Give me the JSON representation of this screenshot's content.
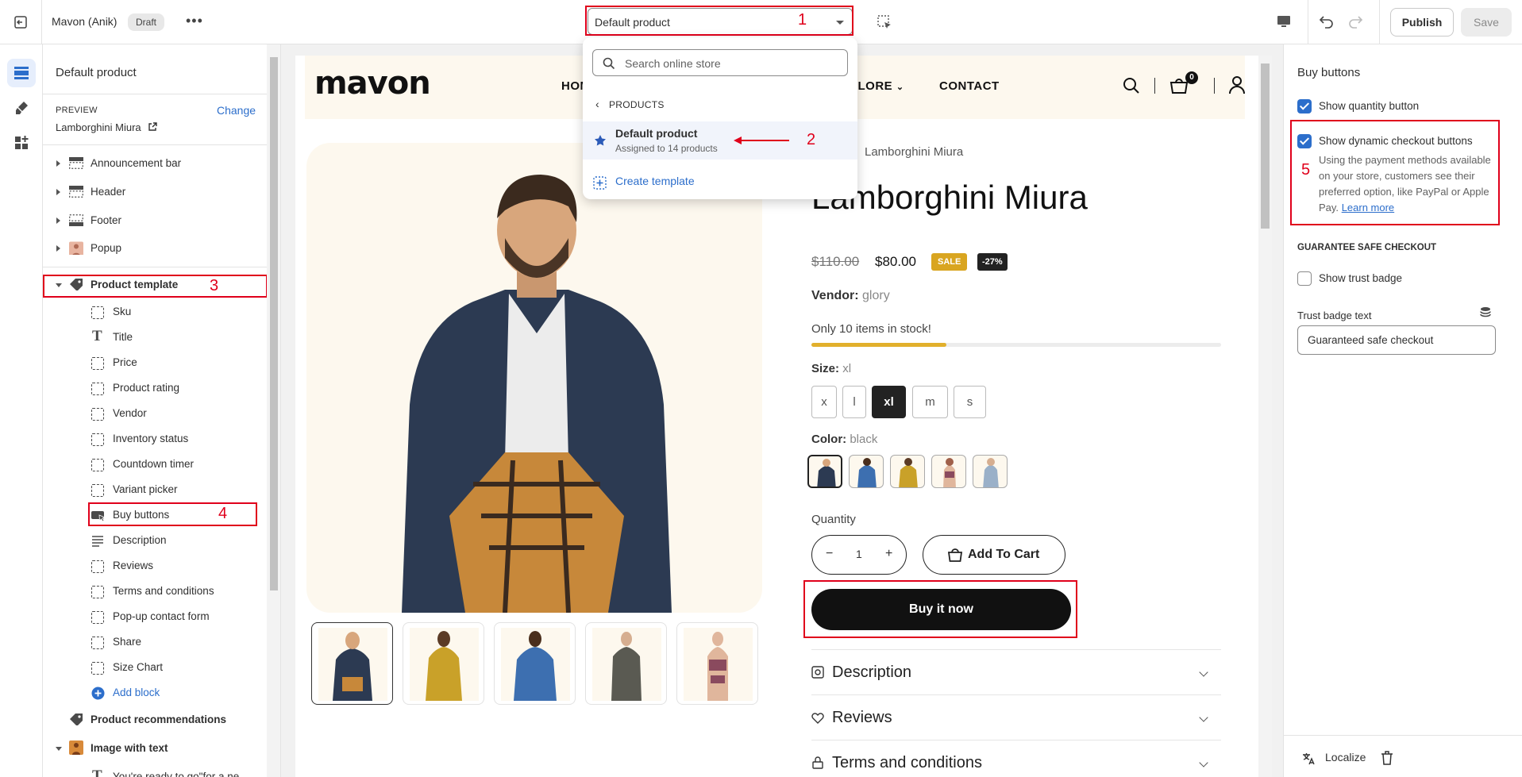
{
  "topbar": {
    "store_name": "Mavon (Anik)",
    "status_badge": "Draft",
    "template_select": "Default product",
    "publish_label": "Publish",
    "save_label": "Save"
  },
  "annotations": [
    "1",
    "2",
    "3",
    "4",
    "5"
  ],
  "template_dropdown": {
    "search_placeholder": "Search online store",
    "back_label": "PRODUCTS",
    "item_name": "Default product",
    "item_sub": "Assigned to 14 products",
    "create_label": "Create template"
  },
  "left_panel": {
    "title": "Default product",
    "preview_label": "PREVIEW",
    "change_label": "Change",
    "preview_product": "Lamborghini Miura",
    "sections": [
      {
        "label": "Announcement bar",
        "icon": "section-icon"
      },
      {
        "label": "Header",
        "icon": "section-icon"
      },
      {
        "label": "Footer",
        "icon": "section-icon"
      },
      {
        "label": "Popup",
        "icon": "image-icon"
      }
    ],
    "product_template": "Product template",
    "blocks": [
      "Sku",
      "Title",
      "Price",
      "Product rating",
      "Vendor",
      "Inventory status",
      "Countdown timer",
      "Variant picker",
      "Buy buttons",
      "Description",
      "Reviews",
      "Terms and conditions",
      "Pop-up contact form",
      "Share",
      "Size Chart"
    ],
    "add_block": "Add block",
    "product_recommendations": "Product recommendations",
    "image_with_text": "Image with text",
    "cut_text": "You're ready to go\"for a ne"
  },
  "store": {
    "logo": "mavon",
    "nav": [
      "HOME",
      "EXPLORE",
      "CONTACT"
    ],
    "cart_count": "0",
    "breadcrumb": "Lamborghini Miura",
    "product_title": "Lamborghini Miura",
    "price_old": "$110.00",
    "price_new": "$80.00",
    "badge_sale": "SALE",
    "badge_off": "-27%",
    "vendor_label": "Vendor:",
    "vendor_value": "glory",
    "stock_text": "Only 10 items in stock!",
    "stock_fraction": 0.33,
    "size_label": "Size:",
    "size_value": "xl",
    "sizes": [
      "x",
      "l",
      "xl",
      "m",
      "s"
    ],
    "color_label": "Color:",
    "color_value": "black",
    "quantity_label": "Quantity",
    "quantity_value": "1",
    "add_to_cart": "Add To Cart",
    "buy_now": "Buy it now",
    "accordions": [
      "Description",
      "Reviews",
      "Terms and conditions"
    ]
  },
  "right_panel": {
    "title": "Buy buttons",
    "show_quantity": "Show quantity button",
    "show_dynamic": "Show dynamic checkout buttons",
    "dynamic_help": "Using the payment methods available on your store, customers see their preferred option, like PayPal or Apple Pay.",
    "learn_more": "Learn more",
    "section_heading": "GUARANTEE SAFE CHECKOUT",
    "show_trust": "Show trust badge",
    "trust_text_label": "Trust badge text",
    "trust_text_value": "Guaranteed safe checkout",
    "localize_label": "Localize"
  },
  "colors": {
    "accent": "#2c6ecb",
    "annotation": "#e0001b",
    "sale": "#d9a520"
  }
}
